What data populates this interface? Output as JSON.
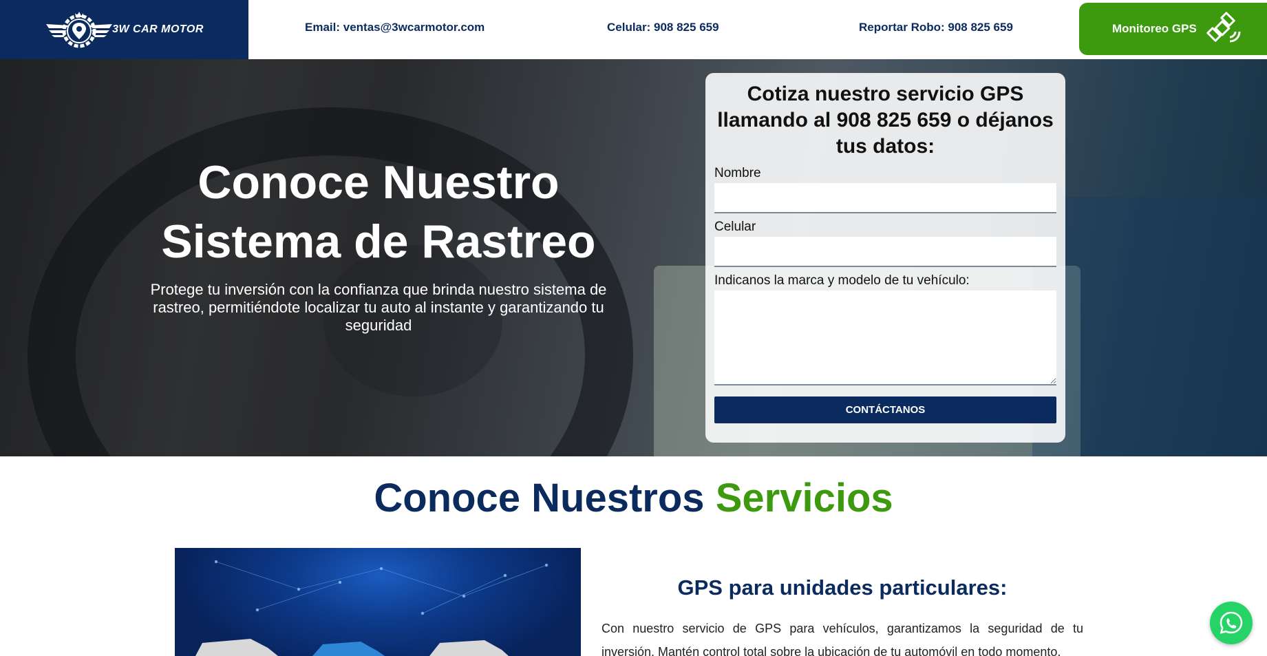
{
  "header": {
    "logo_text": "3W CAR MOTOR",
    "email": "Email: ventas@3wcarmotor.com",
    "phone": "Celular: 908 825 659",
    "theft": "Reportar Robo: 908 825 659",
    "gps_button": "Monitoreo GPS"
  },
  "hero": {
    "title_line1": "Conoce Nuestro",
    "title_line2": "Sistema de Rastreo",
    "subtitle": "Protege tu inversión con la confianza que brinda nuestro sistema de rastreo, permitiéndote localizar tu auto al instante y garantizando tu seguridad"
  },
  "form": {
    "title": "Cotiza nuestro servicio GPS llamando al 908 825 659 o déjanos tus datos:",
    "name_label": "Nombre",
    "name_value": "",
    "phone_label": "Celular",
    "phone_value": "",
    "vehicle_label": "Indicanos la marca y modelo de tu vehículo:",
    "vehicle_value": "",
    "submit": "CONTÁCTANOS"
  },
  "services": {
    "title_part1": "Conoce Nuestros",
    "title_part2": "Servicios",
    "item_heading": "GPS para unidades particulares:",
    "item_text": "Con nuestro servicio de GPS para vehículos, garantizamos la seguridad de tu inversión. Mantén control total sobre la ubicación de tu automóvil en todo momento,"
  },
  "colors": {
    "brand_blue": "#0b2a5e",
    "brand_green": "#3d9a0e",
    "whatsapp": "#25d366"
  },
  "icons": {
    "logo": "gear-pin-wings-icon",
    "gps": "satellite-icon",
    "whatsapp": "whatsapp-icon"
  }
}
